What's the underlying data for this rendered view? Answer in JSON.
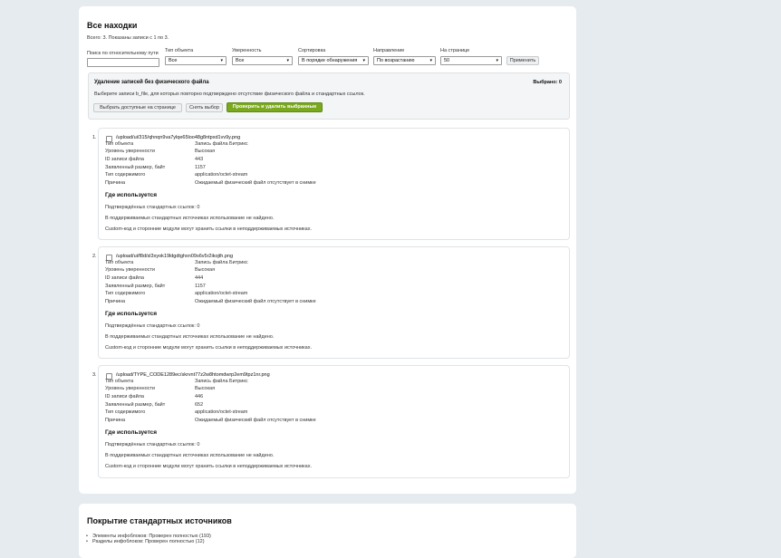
{
  "findings_card": {
    "title": "Все находки",
    "summary": "Всего: 3. Показаны записи с 1 по 3."
  },
  "filters": {
    "search_label": "Поиск по относительному пути",
    "search_value": "",
    "type_label": "Тип объекта",
    "type_value": "Все",
    "confidence_label": "Уверенность",
    "confidence_value": "Все",
    "sort_label": "Сортировка",
    "sort_value": "В порядке обнаружения",
    "direction_label": "Направление",
    "direction_value": "По возрастанию",
    "per_page_label": "На странице",
    "per_page_value": "50",
    "apply_label": "Применить",
    "caret_glyph": "▾"
  },
  "bulk": {
    "title": "Удаление записей без физического файла",
    "selected": "Выбрано: 0",
    "description": "Выберите записи b_file, для которых повторно подтверждено отсутствие физического файла и стандартных ссылок.",
    "select_available_label": "Выбрать доступные на странице",
    "clear_label": "Снять выбор",
    "delete_label": "Проверить и удалить выбранные"
  },
  "labels": {
    "type": "Тип объекта",
    "confidence": "Уровень уверенности",
    "file_id": "ID записи файла",
    "size": "Заявленный размер, байт",
    "content_type": "Тип содержимого",
    "reason": "Причина"
  },
  "findings": [
    {
      "number": "1.",
      "path": "/upload/ui/315/qhnqn9va7ylqe65loo48g8ntpxd1vv9y.png",
      "type": "Запись файла Битрикс",
      "confidence": "Высокая",
      "file_id": "443",
      "size": "1157",
      "content_type": "application/octet-stream",
      "reason": "Ожидаемый физический файл отсутствует в снимке",
      "used_heading": "Где используется",
      "confirmed_refs": "Подтверждённых стандартных ссылок: 0",
      "std_note": "В поддерживаемых стандартных источниках использование не найдено.",
      "custom_note": "Custom-код и сторонние модули могут хранить ссылки в неподдерживаемых источниках."
    },
    {
      "number": "2.",
      "path": "/upload/ui/f8d/sl3xyok19ldgdtghxn09s6v5r2ikojth.png",
      "type": "Запись файла Битрикс",
      "confidence": "Высокая",
      "file_id": "444",
      "size": "1157",
      "content_type": "application/octet-stream",
      "reason": "Ожидаемый физический файл отсутствует в снимке",
      "used_heading": "Где используется",
      "confirmed_refs": "Подтверждённых стандартных ссылок: 0",
      "std_note": "В поддерживаемых стандартных источниках использование не найдено.",
      "custom_note": "Custom-код и сторонние модули могут хранить ссылки в неподдерживаемых источниках."
    },
    {
      "number": "3.",
      "path": "/upload/TYPE_CODE1289ec/skrvnt77z2w8htomdwrp2em9tpz1nr.png",
      "type": "Запись файла Битрикс",
      "confidence": "Высокая",
      "file_id": "446",
      "size": "652",
      "content_type": "application/octet-stream",
      "reason": "Ожидаемый физический файл отсутствует в снимке",
      "used_heading": "Где используется",
      "confirmed_refs": "Подтверждённых стандартных ссылок: 0",
      "std_note": "В поддерживаемых стандартных источниках использование не найдено.",
      "custom_note": "Custom-код и сторонние модули могут хранить ссылки в неподдерживаемых источниках."
    }
  ],
  "coverage": {
    "title": "Покрытие стандартных источников",
    "items": [
      "Элементы инфоблоков: Проверен полностью (193)",
      "Разделы инфоблоков: Проверен полностью (12)"
    ]
  },
  "colors": {
    "page_bg": "#e5ebee",
    "card_bg": "#ffffff",
    "accent_green": "#7aa81f"
  }
}
